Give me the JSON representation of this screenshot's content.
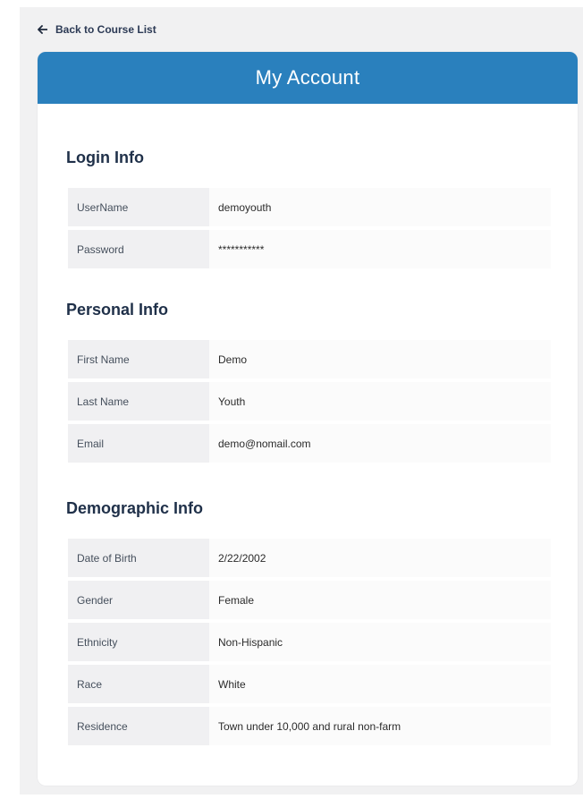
{
  "nav": {
    "back_label": "Back to Course List"
  },
  "header": {
    "title": "My Account"
  },
  "sections": [
    {
      "title": "Login Info",
      "rows": [
        {
          "label": "UserName",
          "value": "demoyouth"
        },
        {
          "label": "Password",
          "value": "***********"
        }
      ]
    },
    {
      "title": "Personal Info",
      "rows": [
        {
          "label": "First Name",
          "value": "Demo"
        },
        {
          "label": "Last Name",
          "value": "Youth"
        },
        {
          "label": "Email",
          "value": "demo@nomail.com"
        }
      ]
    },
    {
      "title": "Demographic Info",
      "rows": [
        {
          "label": "Date of Birth",
          "value": "2/22/2002"
        },
        {
          "label": "Gender",
          "value": "Female"
        },
        {
          "label": "Ethnicity",
          "value": "Non-Hispanic"
        },
        {
          "label": "Race",
          "value": "White"
        },
        {
          "label": "Residence",
          "value": "Town under 10,000 and rural non-farm"
        }
      ]
    }
  ],
  "colors": {
    "header": "#2a80bd",
    "title_text": "#1f3049"
  },
  "icons": {
    "back": "arrow-left-icon"
  }
}
